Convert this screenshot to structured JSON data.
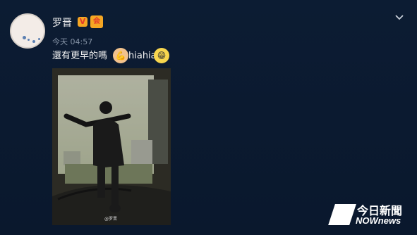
{
  "post": {
    "author": "罗晋",
    "badges": {
      "verified": "V",
      "member": "会"
    },
    "time": "今天 04:57",
    "text_before": "還有更早的嗎",
    "text_after": "hiahia",
    "emoji_1": "flex-arm-emoji",
    "emoji_2": "laugh-emoji",
    "photo_credit": "@罗晋"
  },
  "watermark": {
    "cn": "今日新聞",
    "en": "NOWnews"
  },
  "colors": {
    "background": "#0b1a30",
    "text": "#f4f4f4",
    "muted": "#8592a5",
    "badge": "#f5a623"
  }
}
